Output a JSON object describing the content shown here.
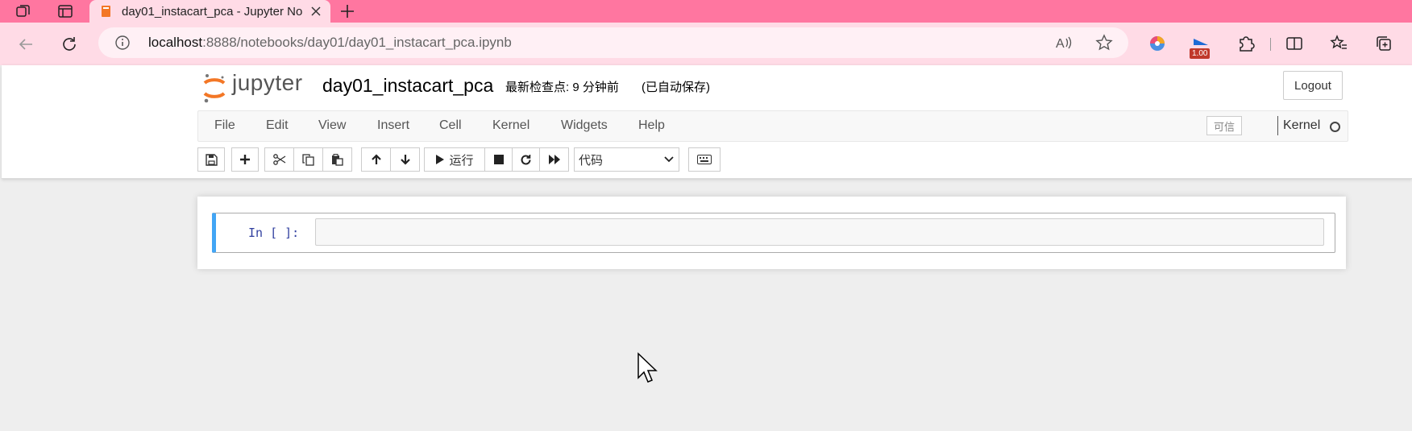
{
  "browser": {
    "tab_title": "day01_instacart_pca - Jupyter No",
    "url_host": "localhost",
    "url_rest": ":8888/notebooks/day01/day01_instacart_pca.ipynb",
    "extension_badge": "1.00"
  },
  "jupyter": {
    "logo_text": "jupyter",
    "notebook_title": "day01_instacart_pca",
    "checkpoint_text": "最新检查点: 9 分钟前",
    "autosave_text": "(已自动保存)",
    "logout_label": "Logout"
  },
  "menu": {
    "items": [
      "File",
      "Edit",
      "View",
      "Insert",
      "Cell",
      "Kernel",
      "Widgets",
      "Help"
    ],
    "trusted_label": "可信",
    "kernel_label": "Kernel"
  },
  "toolbar": {
    "run_label": "运行",
    "cell_type": "代码"
  },
  "cell": {
    "prompt": "In [ ]:",
    "source": ""
  },
  "colors": {
    "tabbar": "#ff76a0",
    "addrbar": "#ffdbe6",
    "cell_selected_border": "#42a5f5",
    "prompt": "#303f9f",
    "jupyter_orange": "#f37726"
  }
}
